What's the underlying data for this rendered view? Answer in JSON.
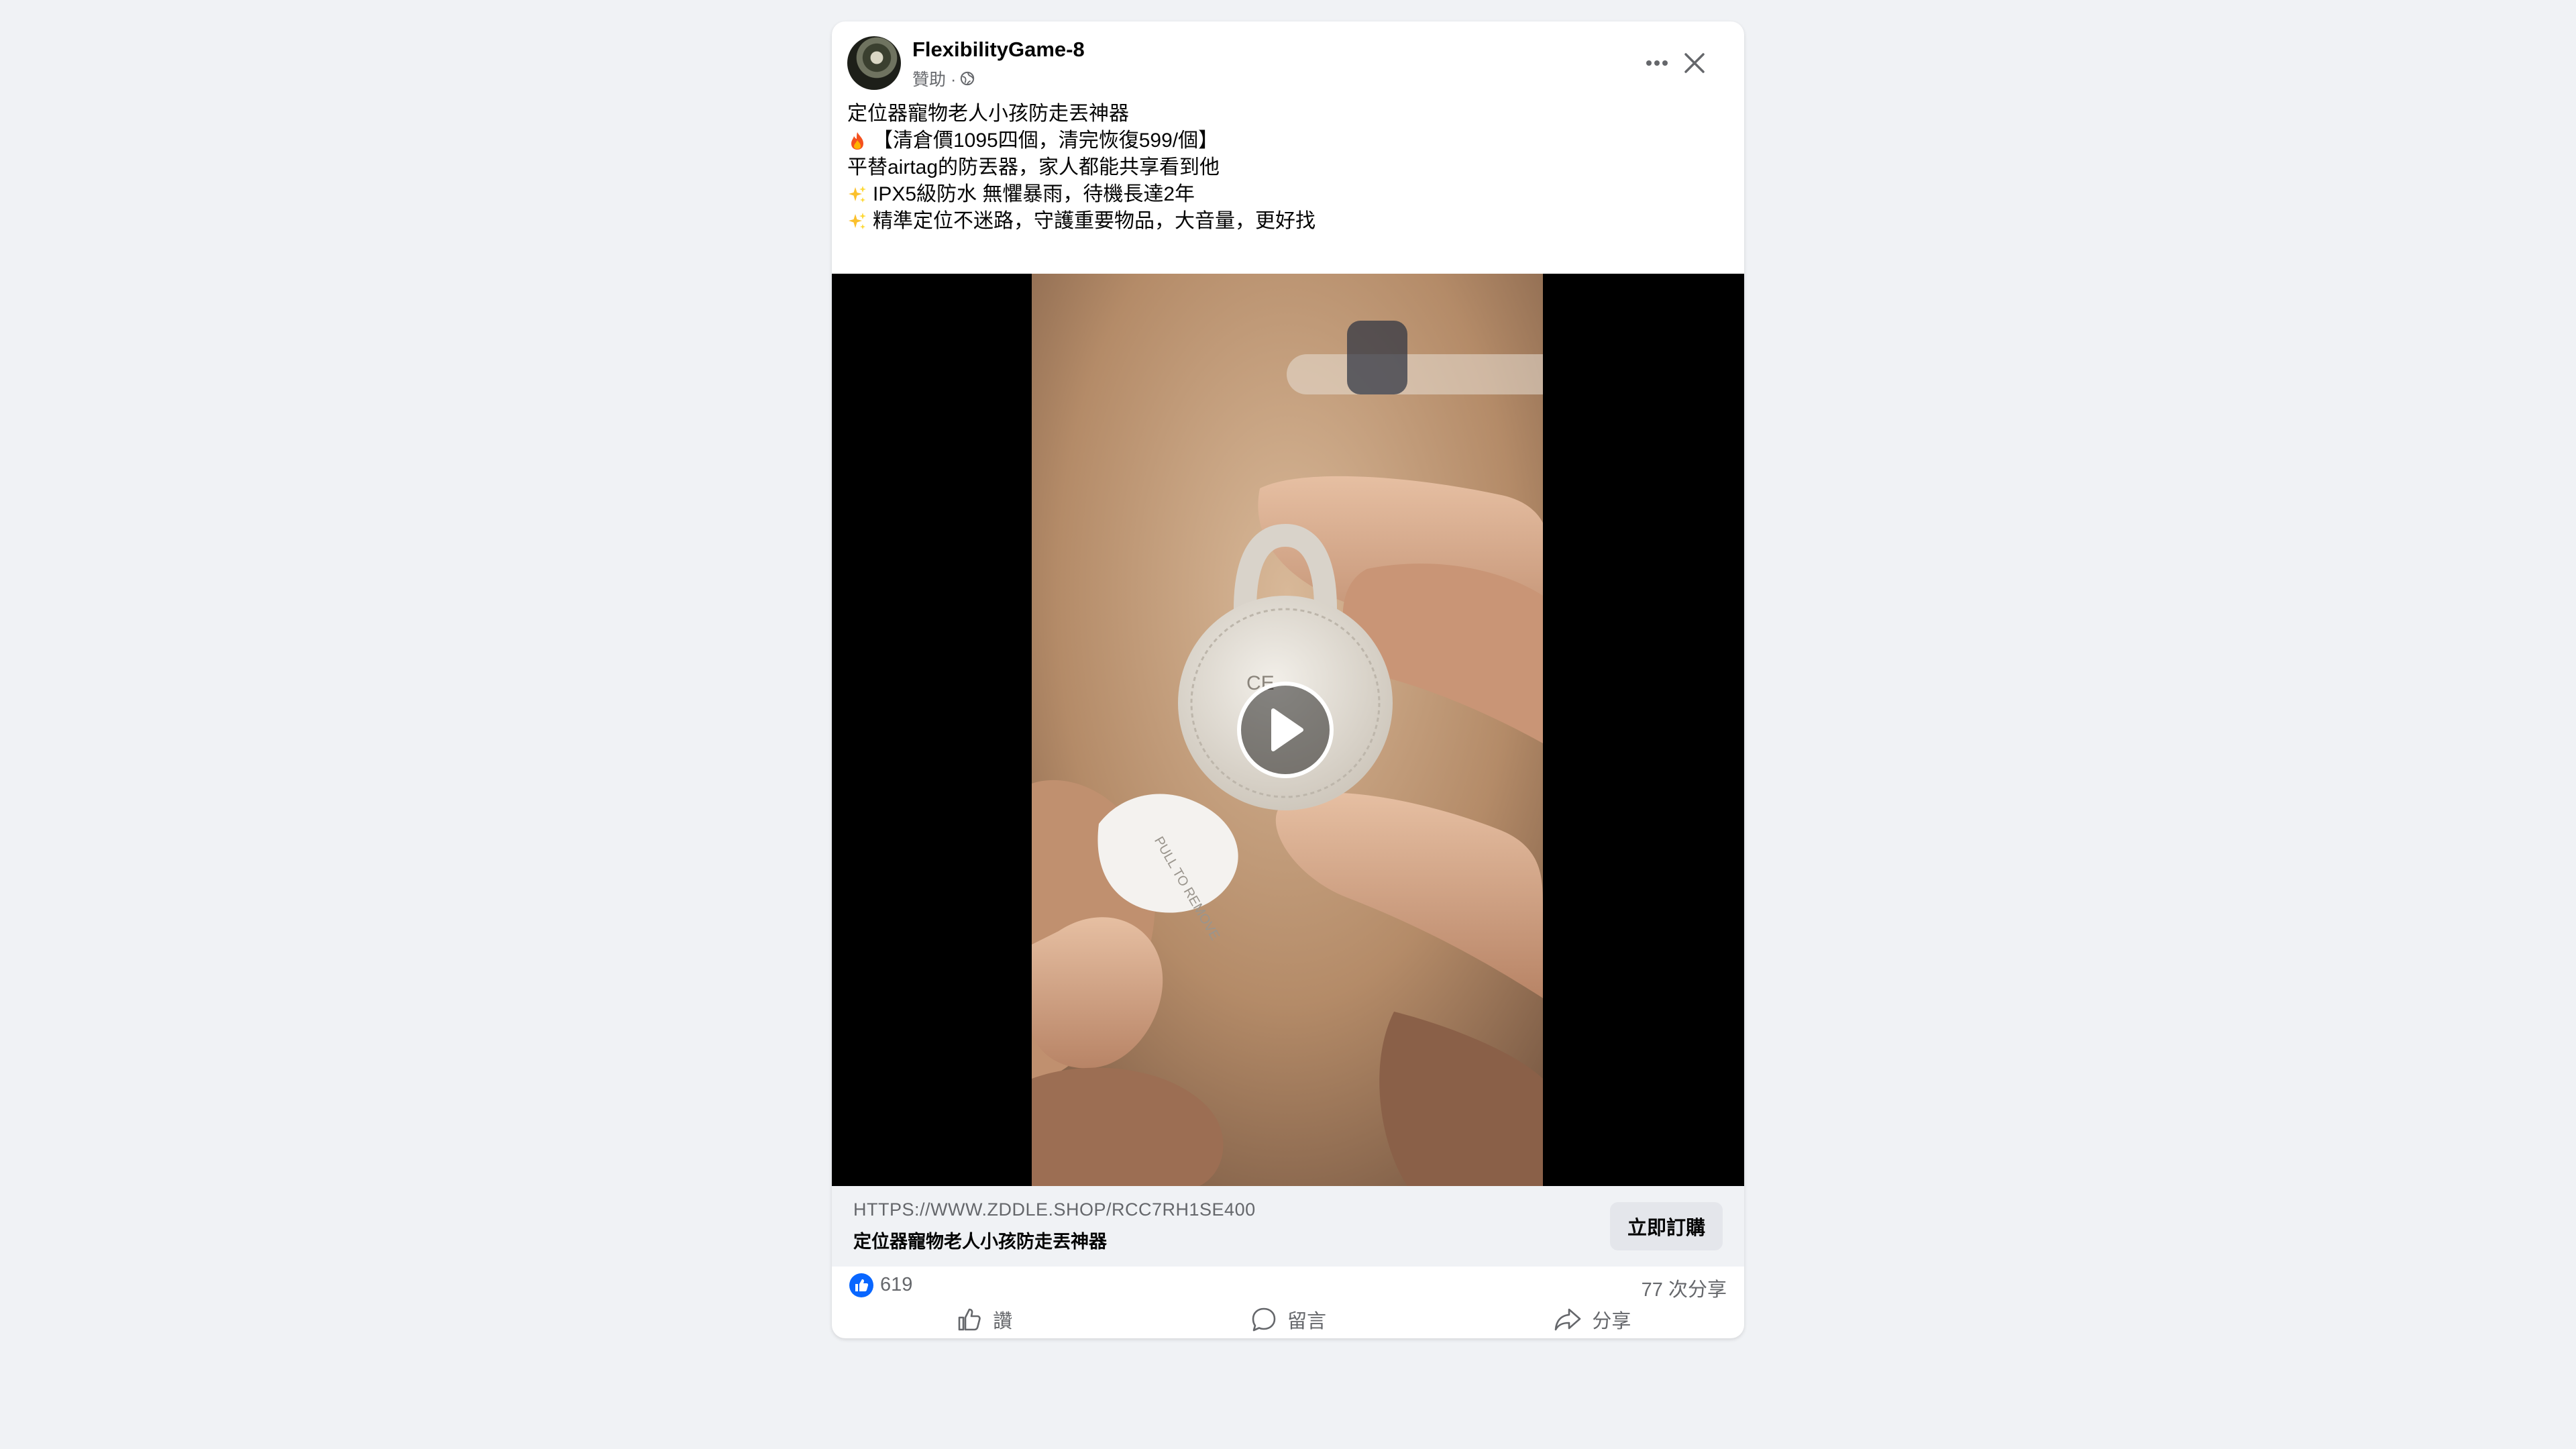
{
  "post": {
    "author": "FlexibilityGame-8",
    "sponsored_label": "贊助 ·",
    "globe_icon": "globe-icon",
    "more_icon": "more-horizontal-icon",
    "close_icon": "close-icon"
  },
  "caption": {
    "line1": "定位器寵物老人小孩防走丟神器",
    "line2": "【清倉價1095四個，清完恢復599/個】",
    "line2_icon": "fire-emoji",
    "line3": "平替airtag的防丟器，家人都能共享看到他",
    "line4": "IPX5級防水 無懼暴雨，待機長達2年",
    "line4_icon": "sparkles-emoji",
    "line5": "精準定位不迷路，守護重要物品，大音量，更好找",
    "line5_icon": "sparkles-emoji"
  },
  "video": {
    "play_icon": "play-icon",
    "tag_text": "PULL TO REMOVE BEFORE USE",
    "device_text": "CE"
  },
  "link": {
    "url": "HTTPS://WWW.ZDDLE.SHOP/RCC7RH1SE400",
    "title": "定位器寵物老人小孩防走丟神器",
    "cta_label": "立即訂購"
  },
  "stats": {
    "reaction_icon": "like-reaction-icon",
    "reactions": "619",
    "shares": "77 次分享"
  },
  "actions": {
    "like_label": "讚",
    "comment_label": "留言",
    "share_label": "分享"
  },
  "colors": {
    "facebook_blue": "#0866ff",
    "secondary_text": "#65676b",
    "background": "#f0f2f5"
  }
}
